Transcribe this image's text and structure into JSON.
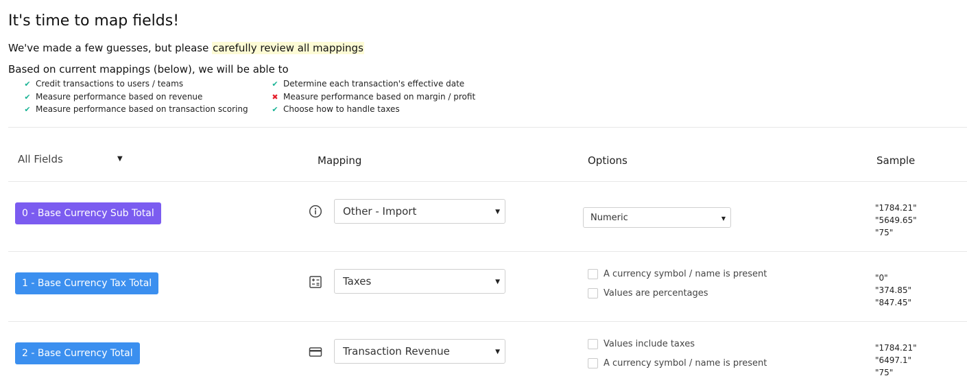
{
  "header": {
    "title": "It's time to map fields!",
    "subtitle_prefix": "We've made a few guesses, but please ",
    "subtitle_highlight": "carefully review all mappings",
    "able_text": "Based on current mappings (below), we will be able to"
  },
  "capabilities": [
    {
      "label": "Credit transactions to users / teams",
      "status": "check",
      "color": "#19b394"
    },
    {
      "label": "Measure performance based on revenue",
      "status": "check",
      "color": "#19b394"
    },
    {
      "label": "Measure performance based on transaction scoring",
      "status": "check",
      "color": "#19b394"
    },
    {
      "label": "Determine each transaction's effective date",
      "status": "check",
      "color": "#19b394"
    },
    {
      "label": "Measure performance based on margin / profit",
      "status": "cross",
      "color": "#e5202d"
    },
    {
      "label": "Choose how to handle taxes",
      "status": "check",
      "color": "#19b394"
    }
  ],
  "table": {
    "filter_label": "All Fields",
    "col_mapping": "Mapping",
    "col_options": "Options",
    "col_sample": "Sample",
    "rows": [
      {
        "field": "0 - Base Currency Sub Total",
        "field_color": "#7b5cf0",
        "mapping_icon": "info-circle-icon",
        "mapping": "Other - Import",
        "option_select": "Numeric",
        "checkboxes": [],
        "samples": [
          "\"1784.21\"",
          "\"5649.65\"",
          "\"75\""
        ]
      },
      {
        "field": "1 - Base Currency Tax Total",
        "field_color": "#3b8fef",
        "mapping_icon": "calculator-icon",
        "mapping": "Taxes",
        "option_select": "",
        "checkboxes": [
          "A currency symbol / name is present",
          "Values are percentages"
        ],
        "samples": [
          "\"0\"",
          "\"374.85\"",
          "\"847.45\""
        ]
      },
      {
        "field": "2 - Base Currency Total",
        "field_color": "#3b8fef",
        "mapping_icon": "credit-card-icon",
        "mapping": "Transaction Revenue",
        "option_select": "",
        "checkboxes": [
          "Values include taxes",
          "A currency symbol / name is present"
        ],
        "samples": [
          "\"1784.21\"",
          "\"6497.1\"",
          "\"75\""
        ]
      }
    ]
  }
}
